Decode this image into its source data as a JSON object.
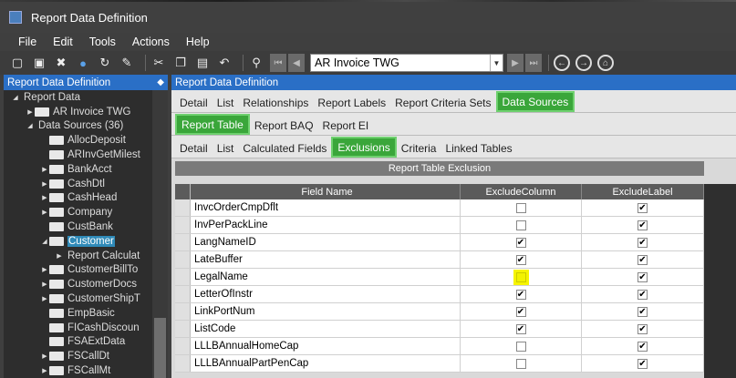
{
  "window": {
    "title": "Report Data Definition"
  },
  "menu": [
    "File",
    "Edit",
    "Tools",
    "Actions",
    "Help"
  ],
  "toolbar": {
    "icons": [
      "new-icon",
      "save-icon",
      "delete-icon",
      "chat-icon",
      "refresh-icon",
      "clear-icon",
      "cut-icon",
      "copy-icon",
      "paste-icon",
      "undo-icon",
      "search-icon"
    ],
    "record": "AR Invoice TWG"
  },
  "left_panel": {
    "title": "Report Data Definition",
    "tree": [
      {
        "label": "Report Data",
        "level": 0,
        "expander": "open",
        "folder": false
      },
      {
        "label": "AR Invoice TWG",
        "level": 1,
        "expander": "closed",
        "folder": true
      },
      {
        "label": "Data Sources (36)",
        "level": 1,
        "expander": "open",
        "folder": false
      },
      {
        "label": "AllocDeposit",
        "level": 2,
        "expander": "none",
        "folder": true
      },
      {
        "label": "ARInvGetMilest",
        "level": 2,
        "expander": "none",
        "folder": true
      },
      {
        "label": "BankAcct",
        "level": 2,
        "expander": "closed",
        "folder": true
      },
      {
        "label": "CashDtl",
        "level": 2,
        "expander": "closed",
        "folder": true
      },
      {
        "label": "CashHead",
        "level": 2,
        "expander": "closed",
        "folder": true
      },
      {
        "label": "Company",
        "level": 2,
        "expander": "closed",
        "folder": true
      },
      {
        "label": "CustBank",
        "level": 2,
        "expander": "none",
        "folder": true
      },
      {
        "label": "Customer",
        "level": 2,
        "expander": "open",
        "folder": true,
        "selected": true
      },
      {
        "label": "Report Calculat",
        "level": 3,
        "expander": "closed",
        "folder": false
      },
      {
        "label": "CustomerBillTo",
        "level": 2,
        "expander": "closed",
        "folder": true
      },
      {
        "label": "CustomerDocs",
        "level": 2,
        "expander": "closed",
        "folder": true
      },
      {
        "label": "CustomerShipT",
        "level": 2,
        "expander": "closed",
        "folder": true
      },
      {
        "label": "EmpBasic",
        "level": 2,
        "expander": "none",
        "folder": true
      },
      {
        "label": "FICashDiscoun",
        "level": 2,
        "expander": "none",
        "folder": true
      },
      {
        "label": "FSAExtData",
        "level": 2,
        "expander": "none",
        "folder": true
      },
      {
        "label": "FSCallDt",
        "level": 2,
        "expander": "closed",
        "folder": true
      },
      {
        "label": "FSCallMt",
        "level": 2,
        "expander": "closed",
        "folder": true
      }
    ]
  },
  "right_panel": {
    "title": "Report Data Definition",
    "tabs1": [
      "Detail",
      "List",
      "Relationships",
      "Report Labels",
      "Report Criteria Sets",
      "Data Sources"
    ],
    "tabs1_active": 5,
    "tabs2": [
      "Report Table",
      "Report BAQ",
      "Report EI"
    ],
    "tabs2_active": 0,
    "tabs3": [
      "Detail",
      "List",
      "Calculated Fields",
      "Exclusions",
      "Criteria",
      "Linked Tables"
    ],
    "tabs3_active": 3,
    "section_title": "Report Table Exclusion",
    "columns": [
      "Field Name",
      "ExcludeColumn",
      "ExcludeLabel"
    ],
    "rows": [
      {
        "field": "InvcOrderCmpDflt",
        "exclude_column": false,
        "exclude_label": true
      },
      {
        "field": "InvPerPackLine",
        "exclude_column": false,
        "exclude_label": true
      },
      {
        "field": "LangNameID",
        "exclude_column": true,
        "exclude_label": true
      },
      {
        "field": "LateBuffer",
        "exclude_column": true,
        "exclude_label": true
      },
      {
        "field": "LegalName",
        "exclude_column": false,
        "exclude_label": true,
        "highlight": true
      },
      {
        "field": "LetterOfInstr",
        "exclude_column": true,
        "exclude_label": true
      },
      {
        "field": "LinkPortNum",
        "exclude_column": true,
        "exclude_label": true
      },
      {
        "field": "ListCode",
        "exclude_column": true,
        "exclude_label": true
      },
      {
        "field": "LLLBAnnualHomeCap",
        "exclude_column": false,
        "exclude_label": true
      },
      {
        "field": "LLLBAnnualPartPenCap",
        "exclude_column": false,
        "exclude_label": true
      }
    ]
  }
}
